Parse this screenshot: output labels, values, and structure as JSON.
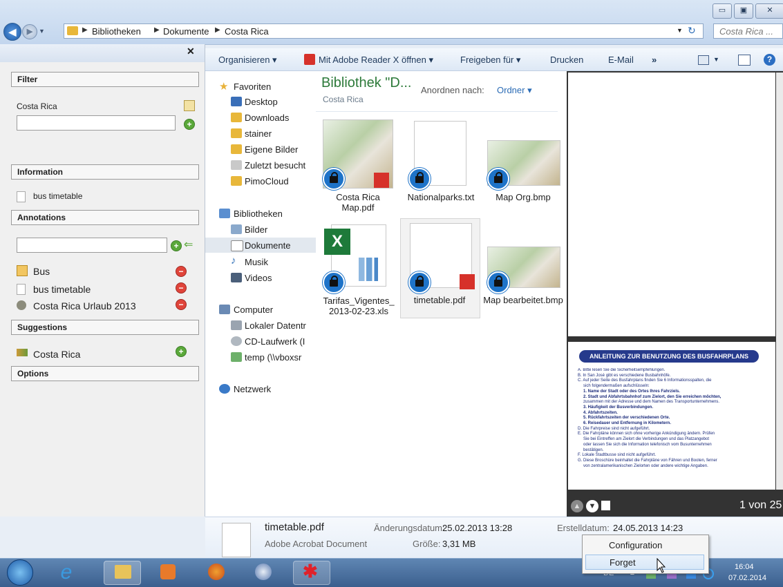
{
  "window": {
    "minimize": "▭",
    "maximize": "▣",
    "close": "✕"
  },
  "address": {
    "crumbs": [
      "Bibliotheken",
      "Dokumente",
      "Costa Rica"
    ],
    "search_placeholder": "Costa Rica ..."
  },
  "left_panel": {
    "close": "✕",
    "filter": {
      "heading": "Filter",
      "value": "Costa Rica"
    },
    "information": {
      "heading": "Information",
      "item": "bus timetable"
    },
    "annotations": {
      "heading": "Annotations",
      "items": [
        "Bus",
        "bus timetable",
        "Costa Rica Urlaub 2013"
      ]
    },
    "suggestions": {
      "heading": "Suggestions",
      "item": "Costa Rica"
    },
    "options": {
      "heading": "Options"
    }
  },
  "toolbar": {
    "organize": "Organisieren ▾",
    "open_with": "Mit Adobe Reader X öffnen ▾",
    "share": "Freigeben für ▾",
    "print": "Drucken",
    "email": "E-Mail",
    "more": "»"
  },
  "nav": {
    "favorites": "Favoriten",
    "fav_items": [
      "Desktop",
      "Downloads",
      "stainer",
      "Eigene Bilder",
      "Zuletzt besucht",
      "PimoCloud"
    ],
    "libraries": "Bibliotheken",
    "lib_items": [
      "Bilder",
      "Dokumente",
      "Musik",
      "Videos"
    ],
    "computer": "Computer",
    "comp_items": [
      "Lokaler Datentr",
      "CD-Laufwerk (I",
      "temp (\\\\vboxsr"
    ],
    "network": "Netzwerk"
  },
  "content": {
    "title": "Bibliothek \"D...",
    "subtitle": "Costa Rica",
    "arrange_label": "Anordnen nach:",
    "arrange_value": "Ordner ▾",
    "files": [
      {
        "name": "Costa Rica Map.pdf"
      },
      {
        "name": "Nationalparks.txt"
      },
      {
        "name": "Map Org.bmp"
      },
      {
        "name": "Tarifas_Vigentes_ 2013-02-23.xls"
      },
      {
        "name": "timetable.pdf"
      },
      {
        "name": "Map bearbeitet.bmp"
      }
    ]
  },
  "preview": {
    "doc_title": "ANLEITUNG ZUR BENUTZUNG DES BUSFAHRPLANS",
    "page_counter": "1 von 25",
    "lines": [
      "A. Bitte lesen Sie die Sicherheitsempfehlungen.",
      "B. In San José gibt es verschiedene Busbahnhöfe.",
      "C. Auf jeder Seite des Busfahrplans finden Sie 6 Informationsspalten, die",
      "sich folgendermaßen aufschlüsseln:",
      "1. Name der Stadt oder des Ortes Ihres Fahrziels.",
      "2. Stadt und Abfahrtsbahnhof zum Zielort, den Sie erreichen möchten,",
      "zusammen mit der Adresse und dem Namen des Transportunternehmens.",
      "3. Häufigkeit der Busverbindungen.",
      "4. Abfahrtszeiten.",
      "5. Rückfahrtszeiten der verschiedenen Orte.",
      "6. Reisedauer und Entfernung in Kilometern.",
      "D. Die Fahrpreise sind nicht aufgeführt.",
      "E. Die Fahrpläne können sich ohne vorherige Ankündigung ändern. Prüfen",
      "Sie bei Eintreffen am Zielort die Verbindungen und das Platzangebot",
      "oder lassen Sie sich die Information telefonisch vom Busunternehmen",
      "bestätigen.",
      "F. Lokale Stadtbusse sind nicht aufgeführt.",
      "G. Diese Broschüre beinhaltet die Fahrpläne von Fähren und Booten, ferner",
      "von zentralamerikanischen Zielorten oder andere wichtige Angaben."
    ]
  },
  "details": {
    "filename": "timetable.pdf",
    "type": "Adobe Acrobat Document",
    "modified_label": "Änderungsdatum:",
    "modified_value": "25.02.2013 13:28",
    "size_label": "Größe:",
    "size_value": "3,31 MB",
    "created_label": "Erstelldatum:",
    "created_value": "24.05.2013 14:23"
  },
  "context_menu": {
    "items": [
      "Configuration",
      "Forget"
    ]
  },
  "taskbar": {
    "lang": "DE",
    "time": "16:04",
    "date": "07.02.2014"
  }
}
